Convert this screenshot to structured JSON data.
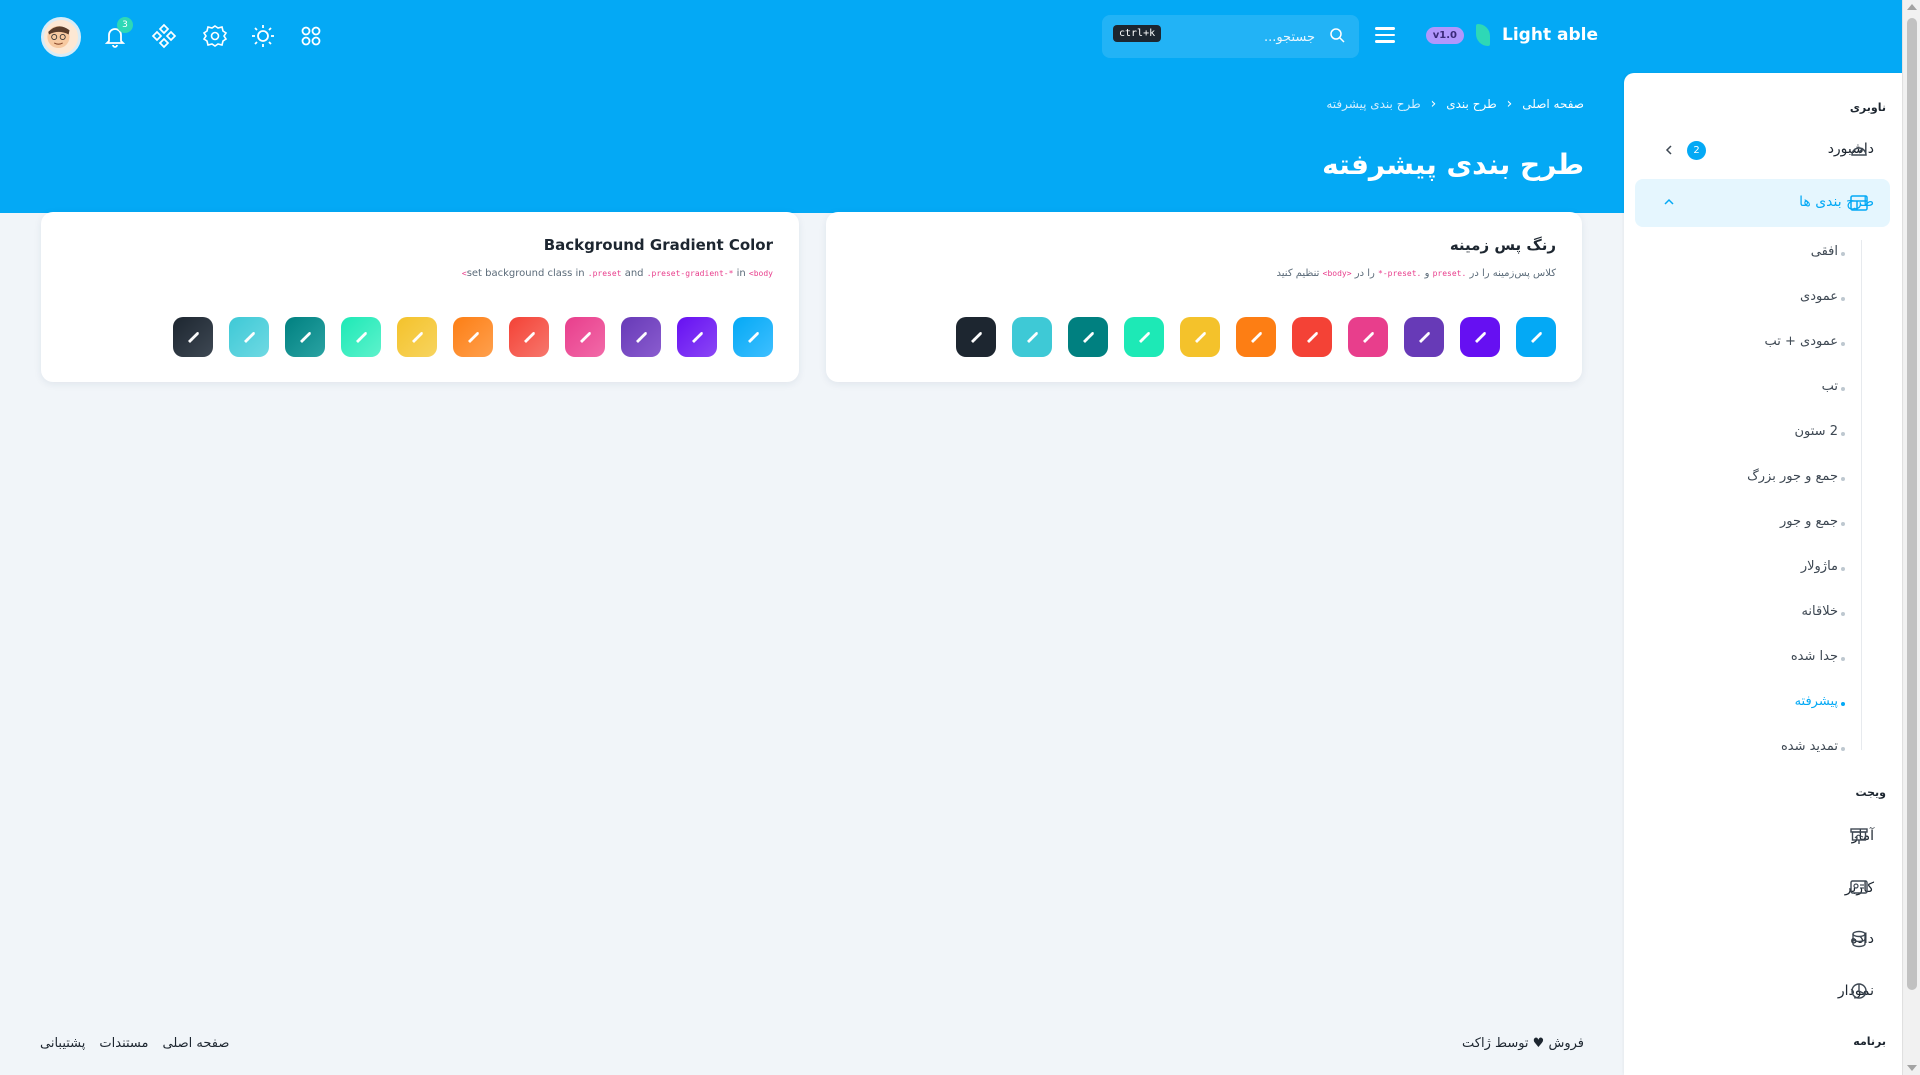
{
  "header": {
    "brand_name": "Light able",
    "version": "v1.0",
    "search_placeholder": "جستجو...",
    "shortcut": "ctrl+k",
    "notification_count": "3"
  },
  "breadcrumb": [
    "صفحه اصلی",
    "طرح بندی",
    "طرح بندی پیشرفته"
  ],
  "page_title": "طرح بندی پیشرفته",
  "cards": [
    {
      "title": "رنگ پس زمینه",
      "desc_before": "کلاس پس‌زمینه را در",
      "code1": ".preset",
      "desc_mid": "و",
      "code2": ".preset-*",
      "desc_mid2": "را در",
      "code3": "<body>",
      "desc_after": "تنظیم کنید"
    },
    {
      "title": "Background Gradient Color",
      "desc_before": "set background class in",
      "code1": ".preset",
      "desc_mid": "and",
      "code2": ".preset-gradient-*",
      "desc_mid2": "in",
      "code3": "<body>",
      "desc_after": ""
    }
  ],
  "preset_colors": [
    "#04a9f5",
    "#6610f2",
    "#673ab7",
    "#e83e8c",
    "#f44236",
    "#fd7e14",
    "#f4c22b",
    "#1de9b6",
    "#008080",
    "#3ec9d6",
    "#1d2630"
  ],
  "gradient_colors": [
    [
      "#04a9f5",
      "#3ebfff"
    ],
    [
      "#6610f2",
      "#8b47f5"
    ],
    [
      "#673ab7",
      "#8a5ccf"
    ],
    [
      "#e83e8c",
      "#f26aa8"
    ],
    [
      "#f44236",
      "#f7776d"
    ],
    [
      "#fd7e14",
      "#fea04e"
    ],
    [
      "#f4c22b",
      "#f7d45f"
    ],
    [
      "#1de9b6",
      "#5ef2cc"
    ],
    [
      "#008080",
      "#2aa3a3"
    ],
    [
      "#3ec9d6",
      "#6fd9e3"
    ],
    [
      "#1d2630",
      "#3e4853"
    ]
  ],
  "sidebar": {
    "caption_nav": "ناوبری",
    "dashboard": "داشبورد",
    "dashboard_count": "2",
    "layouts": "طرح بندی ها",
    "layouts_sub": [
      "افقی",
      "عمودی",
      "عمودی + تب",
      "تب",
      "2 ستون",
      "جمع و جور بزرگ",
      "جمع و جور",
      "ماژولار",
      "خلاقانه",
      "جدا شده",
      "پیشرفته",
      "تمدید شده"
    ],
    "active_sub": "پیشرفته",
    "caption_widget": "ویجت",
    "widget_items": [
      "آمار",
      "کاربر",
      "داده",
      "نمودار"
    ],
    "caption_app": "برنامه"
  },
  "footer": {
    "credit": "فروش ♥ توسط ژاکت",
    "links": [
      "صفحه اصلی",
      "مستندات",
      "پشتیبانی"
    ]
  },
  "icons": [
    "avatar",
    "bell-icon",
    "diamond-icon",
    "gear-icon",
    "sun-icon",
    "apps-icon",
    "search-icon",
    "menu-icon",
    "brush-icon",
    "gauge-icon",
    "layout-icon",
    "chart-board-icon",
    "user-card-icon",
    "database-icon",
    "pie-chart-icon"
  ]
}
